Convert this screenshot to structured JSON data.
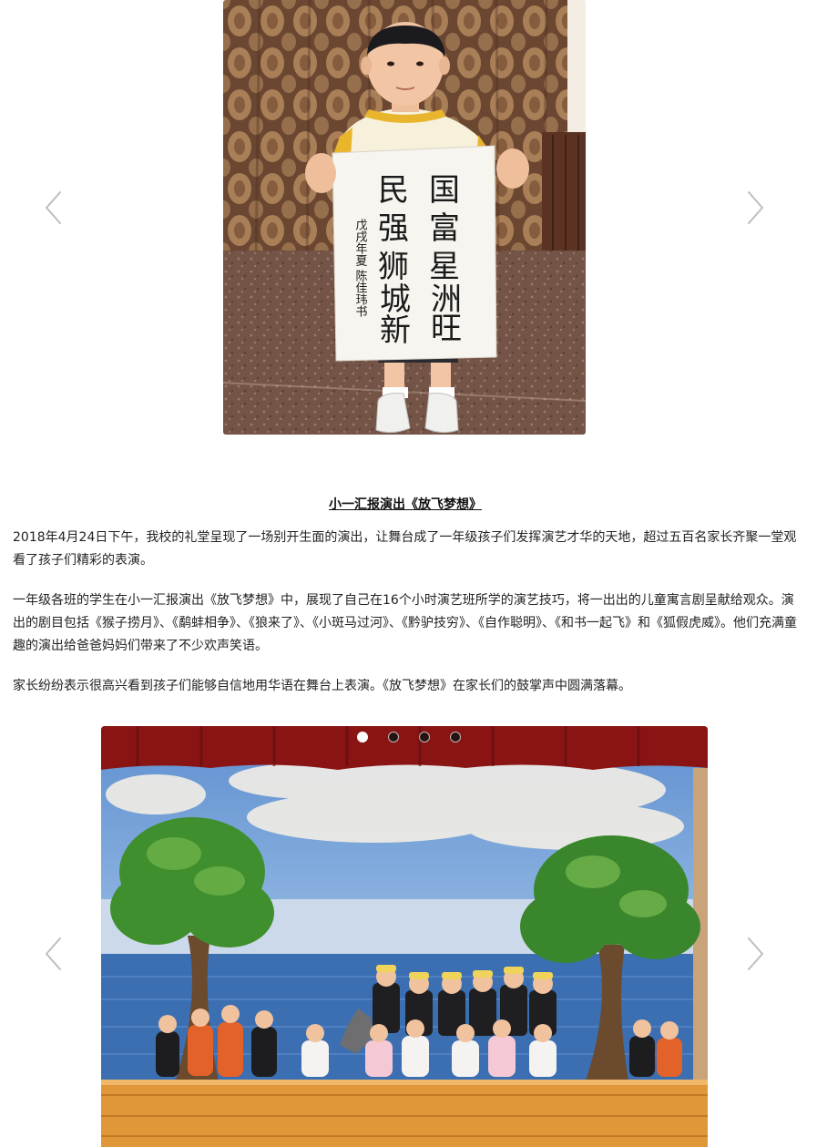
{
  "top_carousel": {
    "photo_alt": "",
    "scroll": {
      "col1": [
        "国",
        "富",
        "星",
        "洲",
        "旺"
      ],
      "col2": [
        "民",
        "强",
        "狮",
        "城",
        "新"
      ],
      "signature": "戊戌年夏 陈佳玮书"
    },
    "prev_icon": "chevron-left-icon",
    "next_icon": "chevron-right-icon"
  },
  "article": {
    "title": "小一汇报演出《放飞梦想》",
    "paragraphs": [
      "2018年4月24日下午，我校的礼堂呈现了一场别开生面的演出，让舞台成了一年级孩子们发挥演艺才华的天地，超过五百名家长齐聚一堂观看了孩子们精彩的表演。",
      "一年级各班的学生在小一汇报演出《放飞梦想》中，展现了自己在16个小时演艺班所学的演艺技巧，将一出出的儿童寓言剧呈献给观众。演出的剧目包括《猴子捞月》、《鹬蚌相争》、《狼来了》、《小斑马过河》、《黔驴技穷》、《自作聪明》、《和书一起飞》和《狐假虎威》。他们充满童趣的演出给爸爸妈妈们带来了不少欢声笑语。",
      "家长纷纷表示很高兴看到孩子们能够自信地用华语在舞台上表演。《放飞梦想》在家长们的鼓掌声中圆满落幕。"
    ]
  },
  "bottom_carousel": {
    "slide_count": 4,
    "active_slide": 1,
    "prev_icon": "chevron-left-icon",
    "next_icon": "chevron-right-icon"
  },
  "colors": {
    "curtain_red": "#8a1414",
    "sky_blue": "#6e9bd6",
    "stage_wood": "#e0973a",
    "tree_green": "#3f8f2e"
  }
}
